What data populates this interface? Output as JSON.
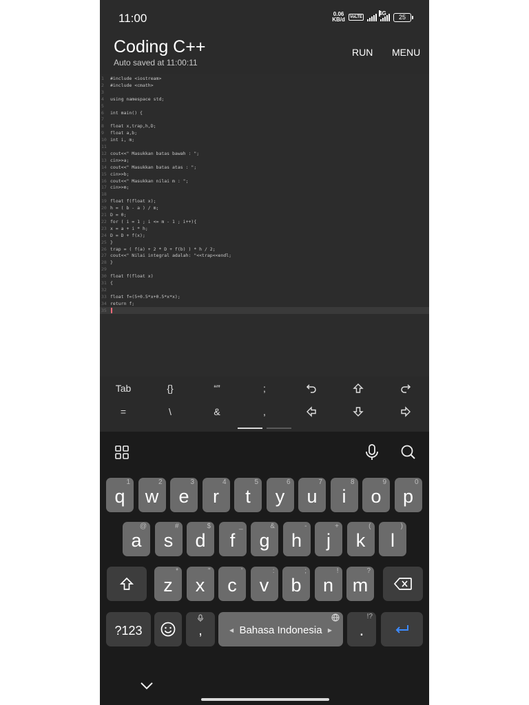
{
  "status": {
    "time": "11:00",
    "netspeed_value": "0.06",
    "netspeed_unit": "KB/d",
    "volte": "VoLTE",
    "network": "4G",
    "battery": "25"
  },
  "app": {
    "title": "Coding C++",
    "subtitle": "Auto saved at 11:00:11",
    "run_label": "RUN",
    "menu_label": "MENU"
  },
  "editor": {
    "lines": [
      "#include <iostream>",
      "#include <cmath>",
      "",
      "using namespace std;",
      "",
      "int main() {",
      "",
      "float x,trap,h,D;",
      "float a,b;",
      "int i, m;",
      "",
      "cout<<\" Masukkan batas bawah : \";",
      "cin>>a;",
      "cout<<\" Masukkan batas atas : \";",
      "cin>>b;",
      "cout<<\" Masukkan nilai m : \";",
      "cin>>m;",
      "",
      "float f(float x);",
      "h = ( b - a ) / m;",
      "D = 0;",
      "for ( i = 1 ; i <= m - 1 ; i++){",
      "x = a + i * h;",
      "D = D + f(x);",
      "}",
      "trap = ( f(a) + 2 * D + f(b) ) * h / 2;",
      "cout<<\" Nilai integral adalah: \"<<trap<<endl;",
      "}",
      "",
      "float f(float x)",
      "{",
      "",
      "float f=(5+0.5*x+0.5*x*x);",
      "return f;",
      ""
    ]
  },
  "extra_keys": {
    "row1": [
      "Tab",
      "{}",
      "“”",
      ";",
      "undo",
      "shift",
      "redo"
    ],
    "row2": [
      "=",
      "\\",
      "&",
      ",",
      "arrow-left",
      "arrow-down",
      "arrow-right"
    ]
  },
  "keyboard": {
    "row1": [
      [
        "q",
        "1"
      ],
      [
        "w",
        "2"
      ],
      [
        "e",
        "3"
      ],
      [
        "r",
        "4"
      ],
      [
        "t",
        "5"
      ],
      [
        "y",
        "6"
      ],
      [
        "u",
        "7"
      ],
      [
        "i",
        "8"
      ],
      [
        "o",
        "9"
      ],
      [
        "p",
        "0"
      ]
    ],
    "row2": [
      [
        "a",
        "@"
      ],
      [
        "s",
        "#"
      ],
      [
        "d",
        "$"
      ],
      [
        "f",
        "_"
      ],
      [
        "g",
        "&"
      ],
      [
        "h",
        "-"
      ],
      [
        "j",
        "+"
      ],
      [
        "k",
        "("
      ],
      [
        "l",
        ")"
      ]
    ],
    "row3": [
      [
        "z",
        "*"
      ],
      [
        "x",
        "\""
      ],
      [
        "c",
        "'"
      ],
      [
        "v",
        ":"
      ],
      [
        "b",
        ";"
      ],
      [
        "n",
        "!"
      ],
      [
        "m",
        "?"
      ]
    ],
    "numbers_label": "?123",
    "comma": ",",
    "period": ".",
    "period_hint": "!?",
    "space_label": "Bahasa Indonesia"
  }
}
